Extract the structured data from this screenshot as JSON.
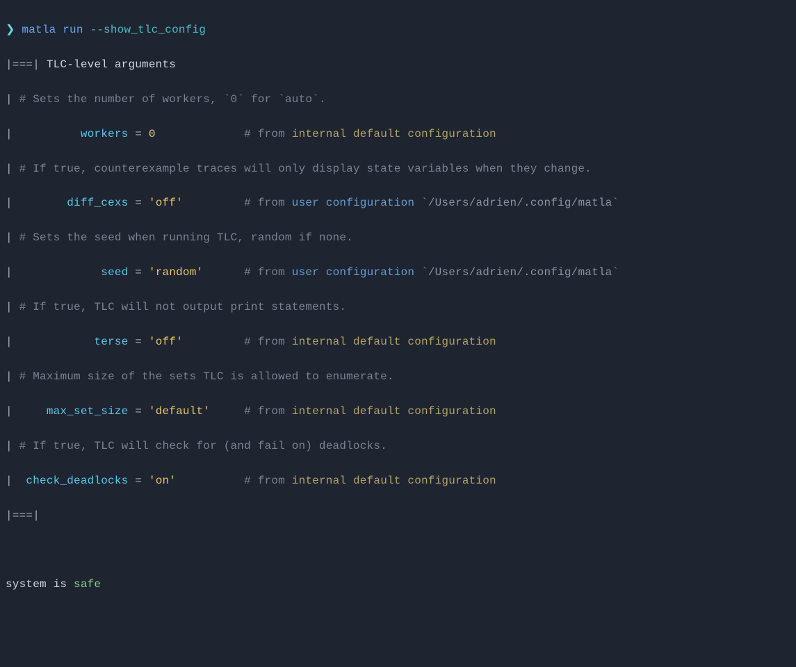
{
  "prompt": {
    "symbol": "❯",
    "command": "matla run",
    "flag": "--show_tlc_config"
  },
  "section": {
    "bar_open": "|===|",
    "bar_close": "|===|",
    "title": "TLC-level arguments"
  },
  "bar": "|",
  "hash": "#",
  "eq": "=",
  "bt": "`",
  "from": "from",
  "sources": {
    "internal": "internal default configuration",
    "user_a": "user configuration",
    "user_b": "`/Users/adrien/.config/matla`"
  },
  "args": [
    {
      "key": "workers",
      "value": "0",
      "pad": "          ",
      "postpad": "             ",
      "doc_a": "Sets the number of workers, ",
      "doc_b": "0",
      "doc_c": " for ",
      "doc_d": "auto",
      "doc_e": "."
    },
    {
      "key": "diff_cexs",
      "value": "'off'",
      "pad": "        ",
      "postpad": "         ",
      "doc": "If true, counterexample traces will only display state variables when they change."
    },
    {
      "key": "seed",
      "value": "'random'",
      "pad": "             ",
      "postpad": "      ",
      "doc": "Sets the seed when running TLC, random if none."
    },
    {
      "key": "terse",
      "value": "'off'",
      "pad": "            ",
      "postpad": "         ",
      "doc": "If true, TLC will not output print statements."
    },
    {
      "key": "max_set_size",
      "value": "'default'",
      "pad": "     ",
      "postpad": "     ",
      "doc": "Maximum size of the sets TLC is allowed to enumerate."
    },
    {
      "key": "check_deadlocks",
      "value": "'on'",
      "pad": "  ",
      "postpad": "          ",
      "doc": "If true, TLC will check for (and fail on) deadlocks."
    }
  ],
  "result": {
    "prefix": "system is",
    "status": "safe"
  }
}
